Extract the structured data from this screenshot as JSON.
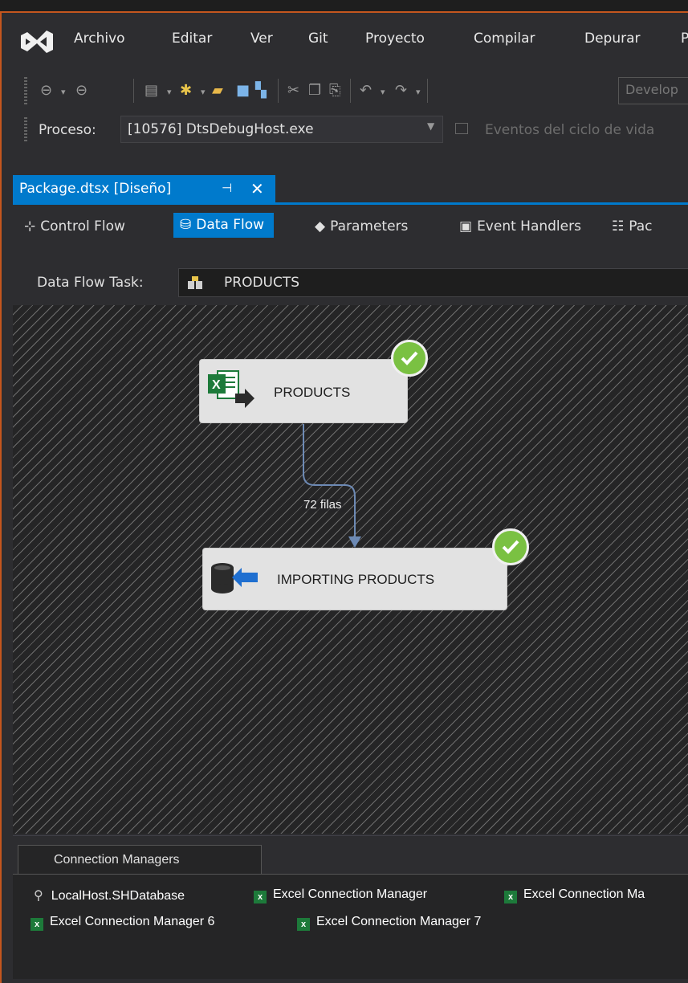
{
  "menu": [
    "Archivo",
    "Editar",
    "Ver",
    "Git",
    "Proyecto",
    "Compilar",
    "Depurar",
    "P"
  ],
  "toolbar": {
    "config_value": "Develop"
  },
  "process": {
    "label": "Proceso:",
    "value": "[10576] DtsDebugHost.exe",
    "lifecycle_label": "Eventos del ciclo de vida"
  },
  "document_tab": {
    "title": "Package.dtsx [Diseño]",
    "pin_glyph": "⊣",
    "close_glyph": "✕"
  },
  "designer_tabs": [
    {
      "label": "Control Flow",
      "icon": "control-flow-icon"
    },
    {
      "label": "Data Flow",
      "icon": "data-flow-icon",
      "active": true
    },
    {
      "label": "Parameters",
      "icon": "parameters-icon"
    },
    {
      "label": "Event Handlers",
      "icon": "event-handlers-icon"
    },
    {
      "label": "Pac",
      "icon": "package-explorer-icon"
    }
  ],
  "data_flow_task": {
    "label": "Data Flow Task:",
    "value": "PRODUCTS"
  },
  "canvas": {
    "source": {
      "label": "PRODUCTS",
      "icon": "excel-source-icon",
      "status": "success"
    },
    "destination": {
      "label": "IMPORTING PRODUCTS",
      "icon": "db-destination-icon",
      "status": "success"
    },
    "path_label": "72 filas"
  },
  "connection_managers": {
    "tab_label": "Connection Managers",
    "items": [
      {
        "label": "LocalHost.SHDatabase",
        "icon": "db-connection-icon"
      },
      {
        "label": "Excel Connection Manager",
        "icon": "excel-connection-icon"
      },
      {
        "label": "Excel Connection Ma",
        "icon": "excel-connection-icon"
      },
      {
        "label": "Excel Connection Manager 6",
        "icon": "excel-connection-icon"
      },
      {
        "label": "Excel Connection Manager 7",
        "icon": "excel-connection-icon"
      }
    ]
  },
  "colors": {
    "accent": "#007acc",
    "frame": "#c4561e",
    "success": "#7ac142"
  }
}
